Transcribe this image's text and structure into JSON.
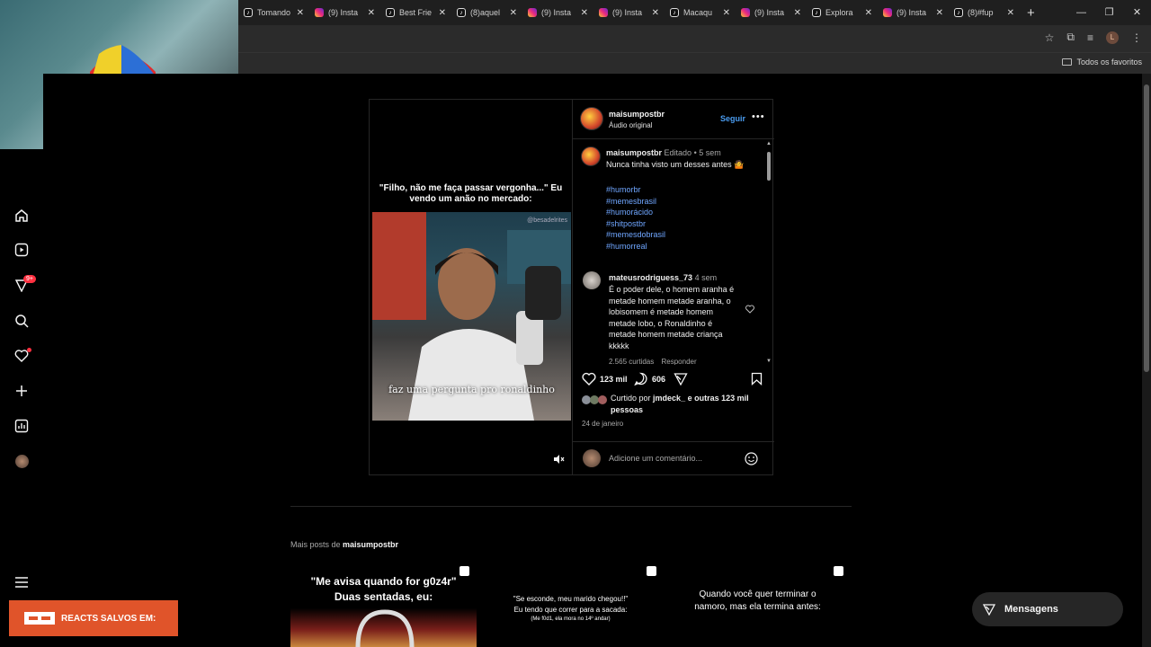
{
  "browser": {
    "tabs": [
      {
        "icon": "tiktok",
        "label": "Tomando"
      },
      {
        "icon": "instagram",
        "label": "(9) Insta"
      },
      {
        "icon": "tiktok",
        "label": "Best Frie"
      },
      {
        "icon": "tiktok",
        "label": "(8)aquel"
      },
      {
        "icon": "instagram",
        "label": "(9) Insta"
      },
      {
        "icon": "instagram",
        "label": "(9) Insta"
      },
      {
        "icon": "tiktok",
        "label": "Macaqu"
      },
      {
        "icon": "instagram",
        "label": "(9) Insta"
      },
      {
        "icon": "tiktok",
        "label": "Explora"
      },
      {
        "icon": "instagram",
        "label": "(9) Insta"
      },
      {
        "icon": "tiktok",
        "label": "(8)#fup"
      }
    ],
    "new_tab": "+",
    "profile_initial": "L",
    "bookmarks_label": "Todos os favoritos"
  },
  "nav": {
    "items": [
      "home",
      "reels",
      "explore",
      "search",
      "notifications",
      "create",
      "dashboard",
      "profile"
    ],
    "explore_badge": "9+"
  },
  "post": {
    "author": "maisumpostbr",
    "audio": "Áudio original",
    "follow_label": "Seguir",
    "video_caption": "\"Filho, não me faça passar vergonha...\" Eu vendo um anão no mercado:",
    "video_subtitle": "faz uma pergunta pro ronaldinho",
    "video_watermark": "@besadelrites",
    "caption": {
      "author": "maisumpostbr",
      "edited": "Editado",
      "time": "5 sem",
      "text": "Nunca tinha visto um desses antes 🤷",
      "hashtags": [
        "#humorbr",
        "#memesbrasil",
        "#humorácido",
        "#shitpostbr",
        "#memesdobrasil",
        "#humorreal"
      ]
    },
    "comment": {
      "author": "mateusrodriguess_73",
      "time": "4 sem",
      "lines": [
        "É o poder dele, o homem aranha é",
        "metade homem metade aranha, o",
        "lobisomem é metade homem",
        "metade lobo, o Ronaldinho é",
        "metade homem metade criança",
        "kkkkk"
      ],
      "likes": "2.565 curtidas",
      "reply": "Responder"
    },
    "likes_count": "123 mil",
    "comments_count": "606",
    "liked_by_prefix": "Curtido por",
    "liked_by_user": "jmdeck_",
    "liked_by_suffix": "e outras 123 mil pessoas",
    "date": "24 de janeiro",
    "add_comment_placeholder": "Adicione um comentário..."
  },
  "more_posts": {
    "prefix": "Mais posts de",
    "author": "maisumpostbr",
    "items": [
      {
        "line1": "\"Me avisa quando for g0z4r\"",
        "line2": "Duas sentadas, eu:"
      },
      {
        "line1": "\"Se esconde, meu marido chegou!!\"",
        "line2": "Eu tendo que correr para a sacada:",
        "line3": "(Me f0d1, ela mora no 14º andar)"
      },
      {
        "line1": "Quando você quer terminar o",
        "line2": "namoro, mas ela termina antes:"
      }
    ]
  },
  "messages_label": "Mensagens",
  "overlay": {
    "reacts_label": "REACTS SALVOS EM:"
  }
}
